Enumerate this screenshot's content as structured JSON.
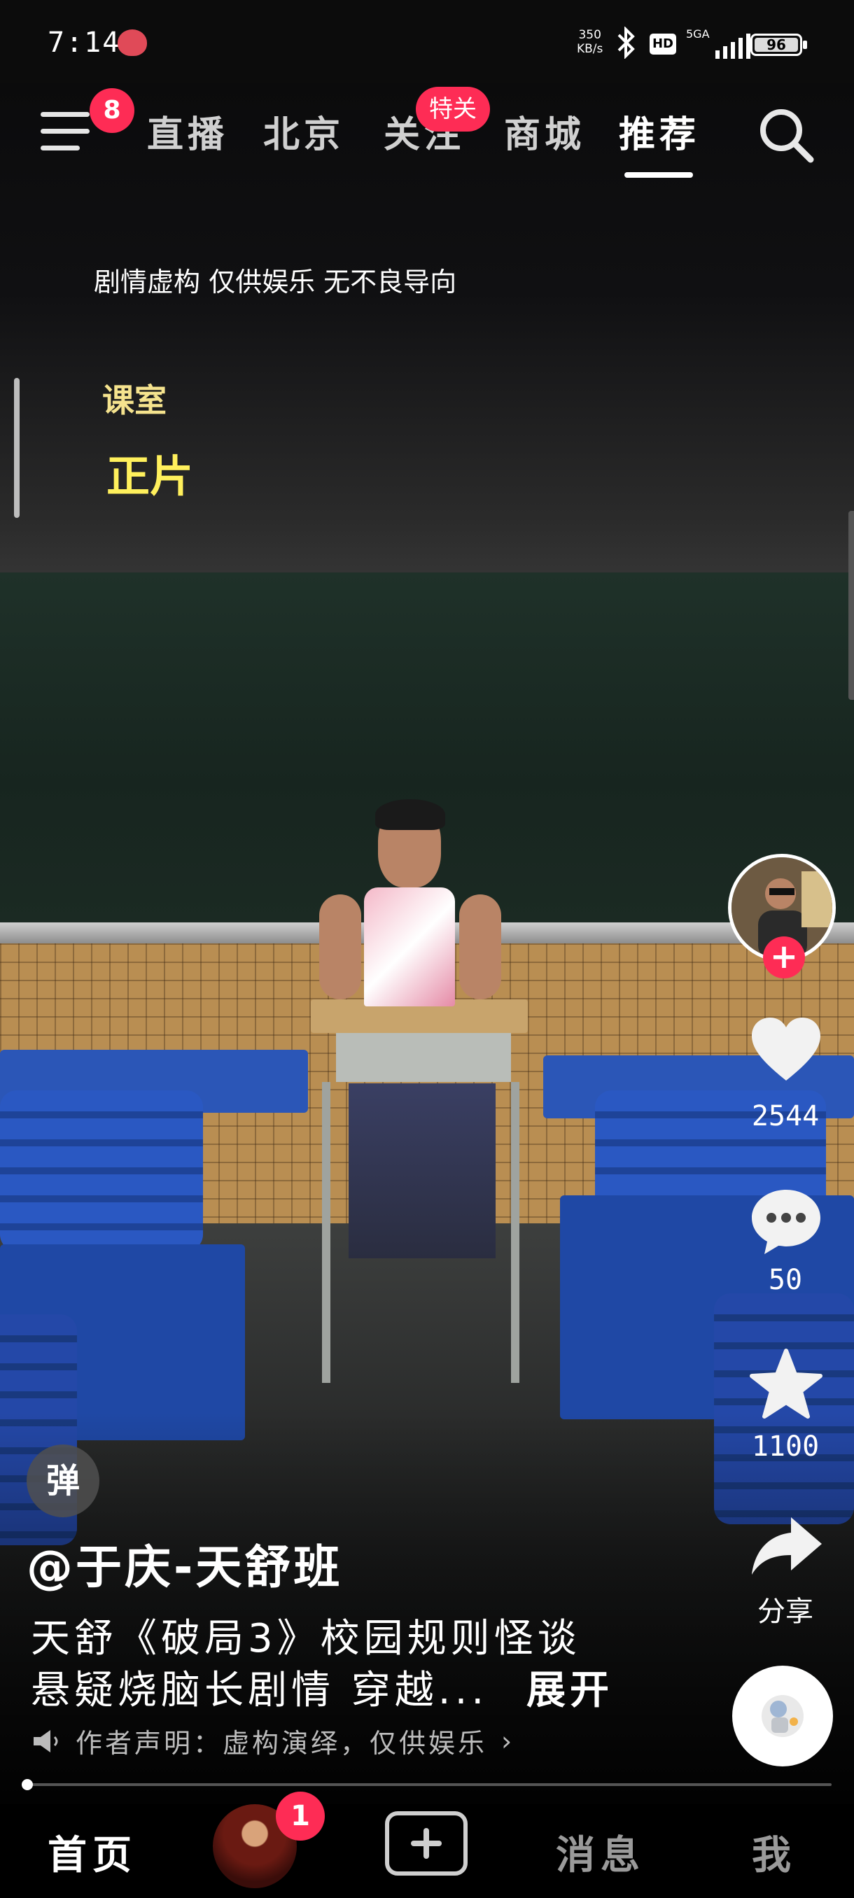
{
  "status_bar": {
    "time": "7:14",
    "net_speed_value": "350",
    "net_speed_unit": "KB/s",
    "hd_label": "HD",
    "network_type": "5GA",
    "battery": "96"
  },
  "top_nav": {
    "menu_badge": "8",
    "tabs": [
      {
        "label": "直播"
      },
      {
        "label": "北京"
      },
      {
        "label": "关注"
      },
      {
        "label": "商城"
      },
      {
        "label": "推荐"
      }
    ],
    "follow_badge": "特关"
  },
  "video": {
    "disclaimer": "剧情虚构 仅供娱乐 无不良导向",
    "scene_label": "课室",
    "scene_title": "正片"
  },
  "actions": {
    "like_count": "2544",
    "comment_count": "50",
    "favorite_count": "1100",
    "share_label": "分享"
  },
  "caption": {
    "danmu_label": "弹",
    "author": "@于庆-天舒班",
    "line1": "天舒《破局3》校园规则怪谈",
    "line2": "悬疑烧脑长剧情 穿越...",
    "expand": "展开",
    "notice": "作者声明：虚构演绎，仅供娱乐"
  },
  "progress": {
    "fraction": 0.006
  },
  "bottom_nav": {
    "home": "首页",
    "friends_badge": "1",
    "messages": "消息",
    "me": "我"
  }
}
